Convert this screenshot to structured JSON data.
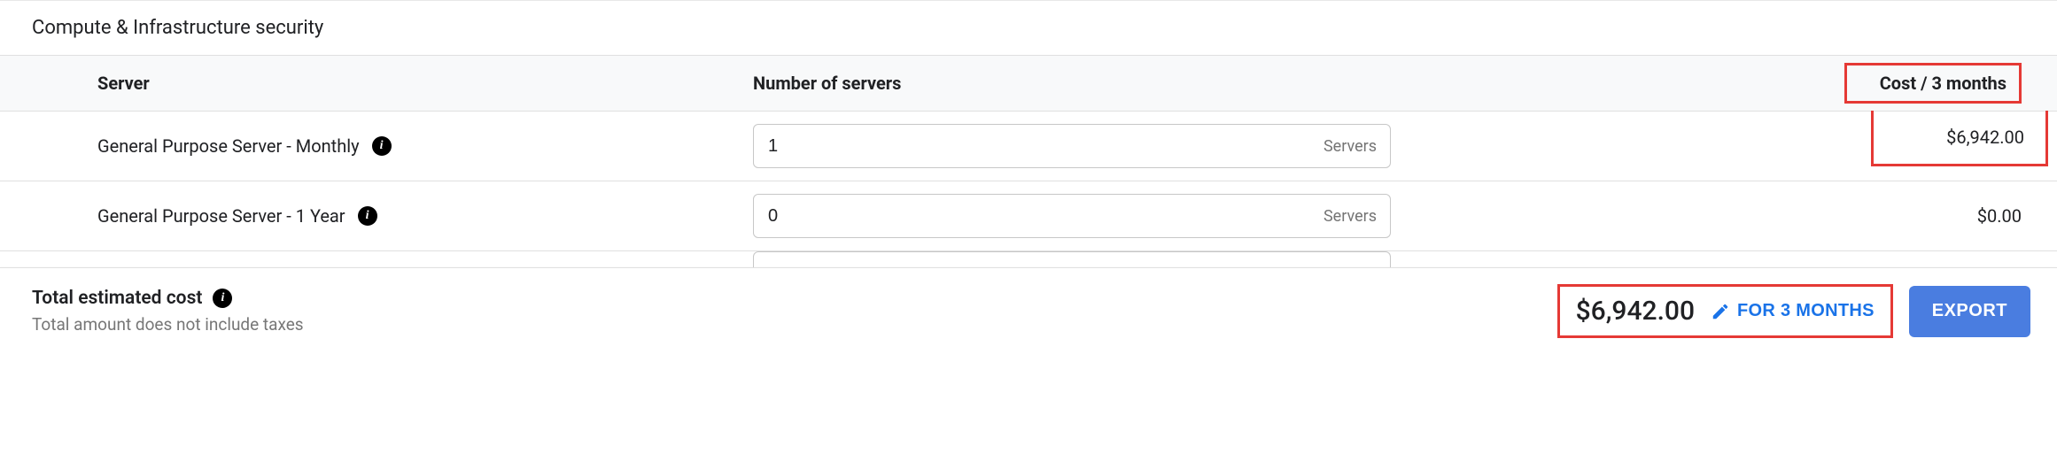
{
  "section": {
    "title": "Compute & Infrastructure security"
  },
  "table": {
    "headers": {
      "server": "Server",
      "number": "Number of servers",
      "cost": "Cost / 3 months"
    },
    "input_suffix": "Servers",
    "rows": [
      {
        "label": "General Purpose Server - Monthly",
        "value": "1",
        "cost": "$6,942.00",
        "highlight": true
      },
      {
        "label": "General Purpose Server - 1 Year",
        "value": "0",
        "cost": "$0.00",
        "highlight": false
      }
    ]
  },
  "footer": {
    "title": "Total estimated cost",
    "subtitle": "Total amount does not include taxes",
    "total": "$6,942.00",
    "period_label": "FOR 3 MONTHS",
    "export_label": "EXPORT"
  }
}
